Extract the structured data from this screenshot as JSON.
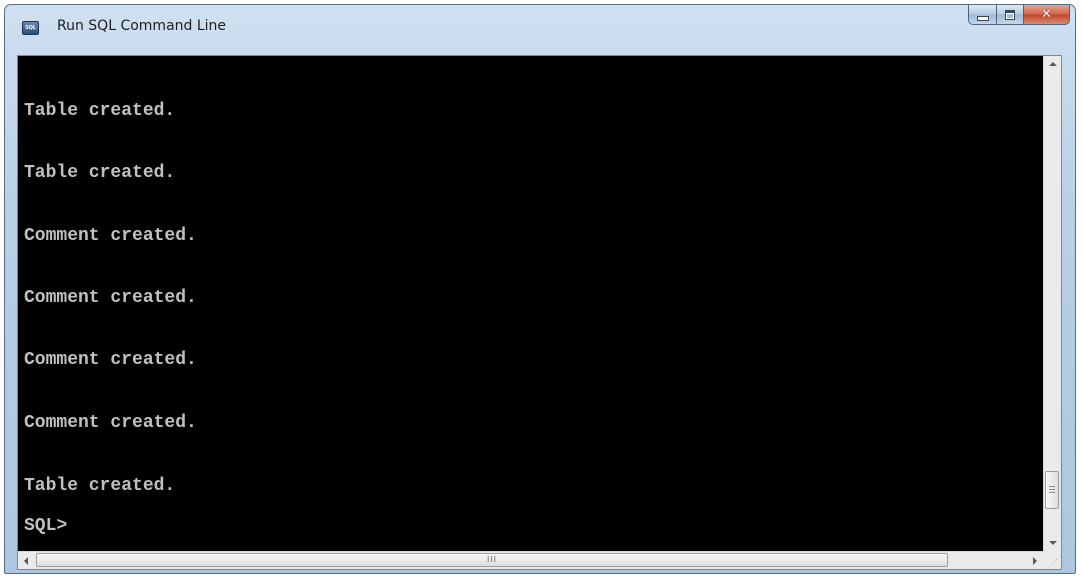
{
  "window": {
    "title": "Run SQL Command Line",
    "icon": "sql-icon",
    "icon_text": "SQL"
  },
  "console": {
    "lines": [
      "Table created.",
      "Table created.",
      "Comment created.",
      "Comment created.",
      "Comment created.",
      "Comment created.",
      "Table created.",
      "SQL>"
    ],
    "text_color": "#c0c0c0",
    "background": "#000000"
  },
  "scrollbars": {
    "h_thumb_grip": "III"
  }
}
